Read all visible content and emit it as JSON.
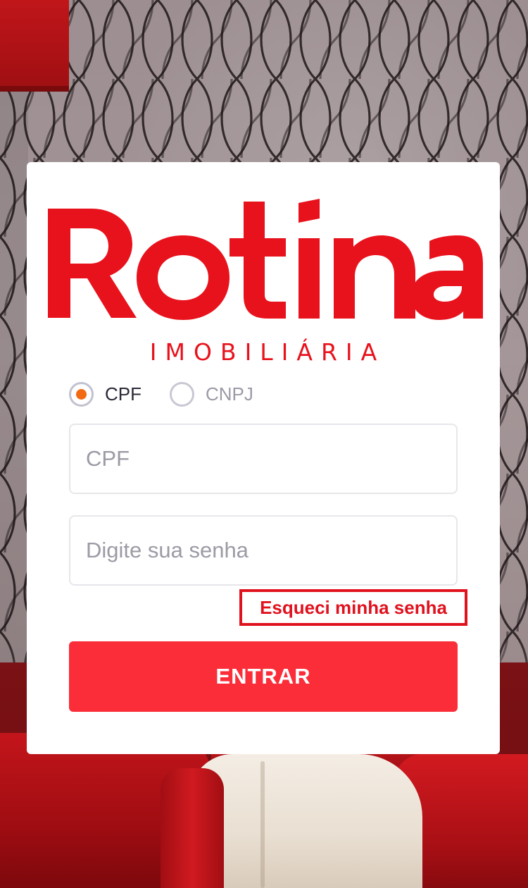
{
  "brand": {
    "name": "Rotina",
    "tagline": "IMOBILIÁRIA",
    "color": "#e8121c"
  },
  "login": {
    "document_type": {
      "options": [
        {
          "label": "CPF",
          "selected": true
        },
        {
          "label": "CNPJ",
          "selected": false
        }
      ],
      "selected_color": "#f26a12"
    },
    "cpf_field": {
      "placeholder": "CPF",
      "value": ""
    },
    "password_field": {
      "placeholder": "Digite sua senha",
      "value": ""
    },
    "forgot_password": "Esqueci minha senha",
    "submit_label": "ENTRAR",
    "submit_color": "#fb2d39"
  }
}
